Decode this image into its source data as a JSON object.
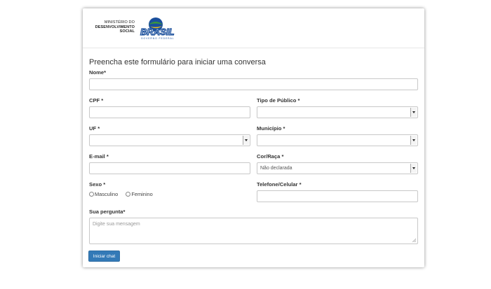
{
  "header": {
    "ministry_line1": "MINISTÉRIO DO",
    "ministry_line2": "DESENVOLVIMENTO",
    "ministry_line3": "SOCIAL",
    "logo_text": "BRASIL",
    "logo_subtext": "GOVERNO FEDERAL"
  },
  "form": {
    "title": "Preencha este formulário para iniciar uma conversa",
    "nome_label": "Nome*",
    "cpf_label": "CPF *",
    "tipo_publico_label": "Tipo de Público *",
    "uf_label": "UF *",
    "municipio_label": "Município *",
    "email_label": "E-mail *",
    "cor_raca_label": "Cor/Raça *",
    "cor_raca_value": "Não declarada",
    "sexo_label": "Sexo *",
    "sexo_options": [
      "Masculino",
      "Feminino"
    ],
    "telefone_label": "Telefone/Celular *",
    "pergunta_label": "Sua pergunta*",
    "pergunta_placeholder": "Digite sua mensagem",
    "submit_label": "Iniciar chat"
  },
  "colors": {
    "button_bg": "#337ab7",
    "logo_blue": "#1a4f9c",
    "logo_green": "#3a9a3a",
    "logo_yellow": "#f3c21a"
  }
}
